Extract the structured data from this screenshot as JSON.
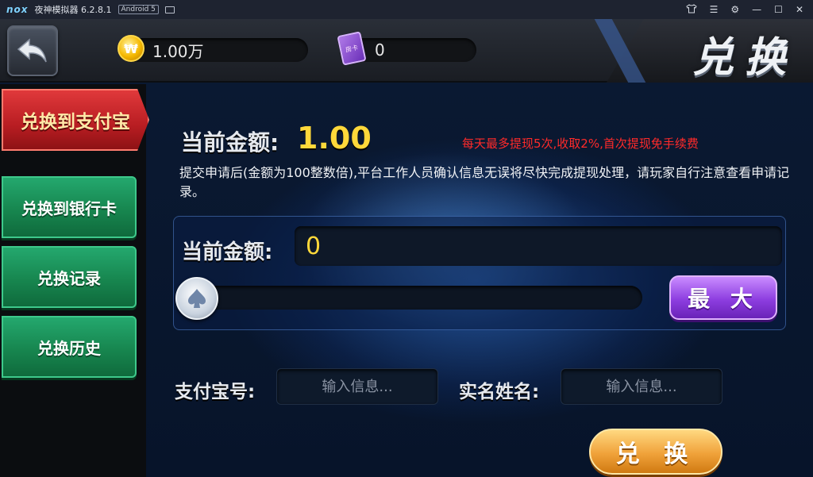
{
  "emulator": {
    "logo": "nox",
    "title": "夜神模拟器 6.2.8.1",
    "badge": "Android 5",
    "controls": [
      "shirt-icon",
      "menu-icon",
      "gear-icon",
      "minimize-icon",
      "maximize-icon",
      "close-icon"
    ]
  },
  "header": {
    "gold_amount": "1.00万",
    "card_count": "0",
    "card_icon_text": "房卡",
    "title": "兑换"
  },
  "tabs": [
    {
      "label": "兑换到支付宝",
      "active": true
    },
    {
      "label": "兑换到银行卡",
      "active": false
    },
    {
      "label": "兑换记录",
      "active": false
    },
    {
      "label": "兑换历史",
      "active": false
    }
  ],
  "content": {
    "current_label": "当前金额:",
    "current_value": "1.00",
    "notice": "每天最多提现5次,收取2%,首次提现免手续费",
    "description": "提交申请后(金额为100整数倍),平台工作人员确认信息无误将尽快完成提现处理，请玩家自行注意查看申请记录。",
    "amount_label": "当前金额:",
    "amount_value": "0",
    "slider_fraction": 0,
    "max_label": "最 大",
    "alipay_label": "支付宝号:",
    "alipay_placeholder": "输入信息...",
    "name_label": "实名姓名:",
    "name_placeholder": "输入信息...",
    "submit_label": "兑 换"
  },
  "colors": {
    "active_tab": "#c8242a",
    "tab": "#1b9a5c",
    "gold_text": "#ffd83a",
    "notice": "#ff2a2a",
    "max_button": "#8d3ee0",
    "submit_button": "#f0a23a"
  }
}
